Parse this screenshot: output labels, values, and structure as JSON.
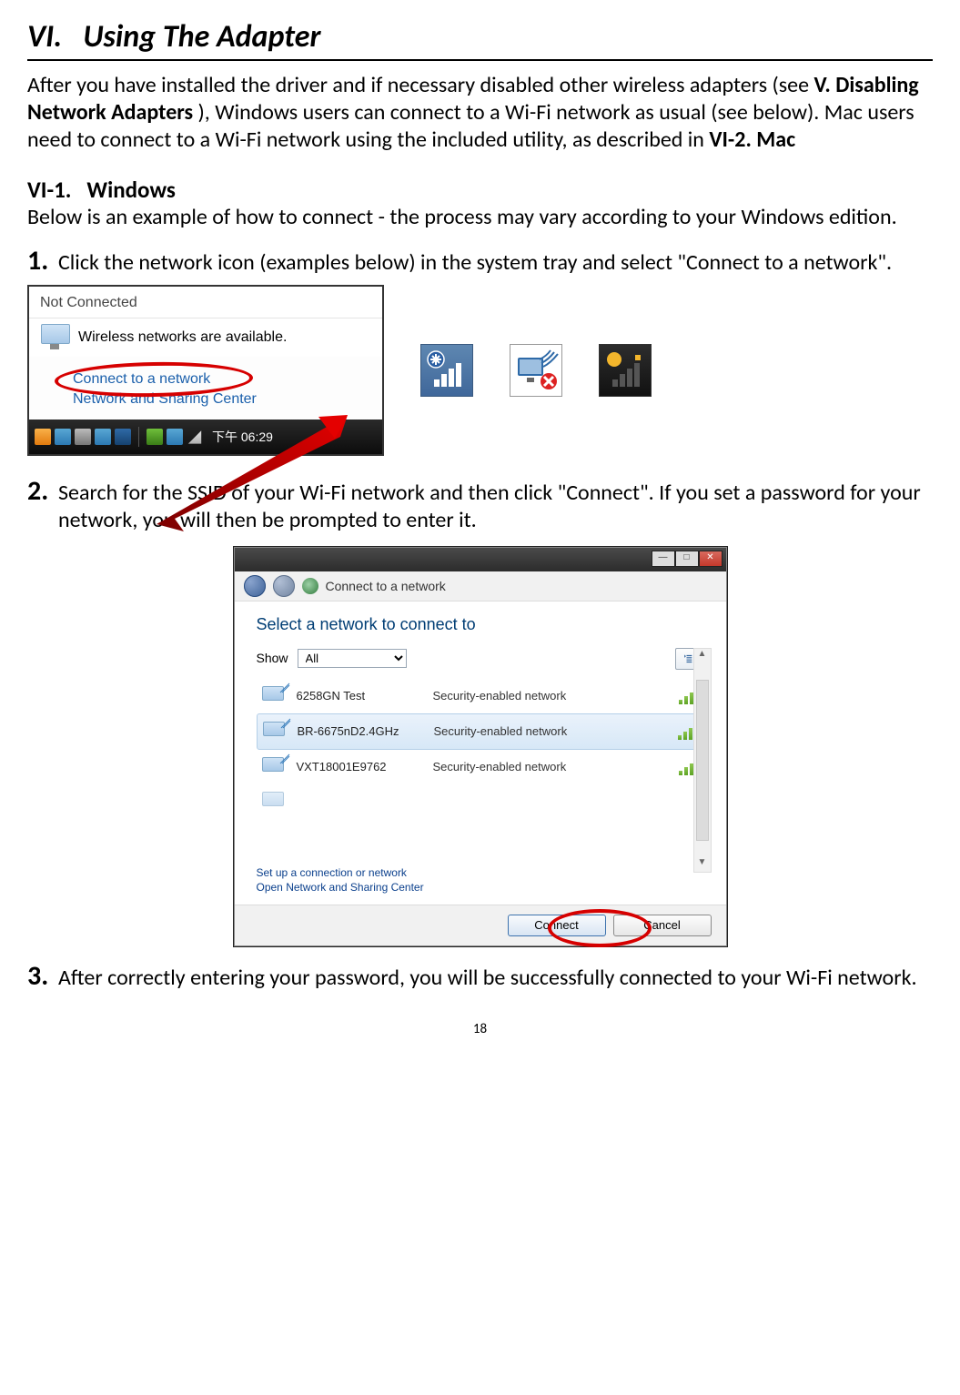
{
  "section": {
    "number": "VI.",
    "title": "Using The Adapter"
  },
  "intro": {
    "text1": "After you have installed the driver and if necessary disabled other wireless adapters (see ",
    "bold1": "V. Disabling Network Adapters",
    "text2": "), Windows users can connect to a Wi-Fi network as usual (see below). Mac users need to connect to a Wi-Fi network using the included utility, as described in ",
    "bold2": "VI-2. Mac"
  },
  "subsection": {
    "number": "VI-1.",
    "title": "Windows",
    "lead": "Below is an example of how to connect - the process may vary according to your Windows edition."
  },
  "step1": {
    "num": "1.",
    "text": "Click the network icon (examples below) in the system tray and select \"Connect to a network\"."
  },
  "popup1": {
    "status": "Not Connected",
    "available": "Wireless networks are available.",
    "link_connect": "Connect to a network",
    "link_center": "Network and Sharing Center",
    "time": "下午 06:29"
  },
  "tray_icon_names": {
    "a": "signal-asterisk-icon",
    "b": "monitor-x-icon",
    "c": "signal-warn-icon"
  },
  "step2": {
    "num": "2.",
    "text": "Search for the SSID of your Wi-Fi network and then click \"Connect\". If you set a password for your network, you will then be prompted to enter it."
  },
  "dialog2": {
    "addr": "Connect to a network",
    "title": "Select a network to connect to",
    "show_label": "Show",
    "show_value": "All",
    "networks": [
      {
        "name": "6258GN Test",
        "sec": "Security-enabled network",
        "bars": 3
      },
      {
        "name": "BR-6675nD2.4GHz",
        "sec": "Security-enabled network",
        "bars": 4
      },
      {
        "name": "VXT18001E9762",
        "sec": "Security-enabled network",
        "bars": 4
      }
    ],
    "link_setup": "Set up a connection or network",
    "link_center": "Open Network and Sharing Center",
    "btn_connect": "Connect",
    "btn_cancel": "Cancel"
  },
  "step3": {
    "num": "3.",
    "text": "After correctly entering your password, you will be successfully connected to your Wi-Fi network."
  },
  "page_number": "18"
}
